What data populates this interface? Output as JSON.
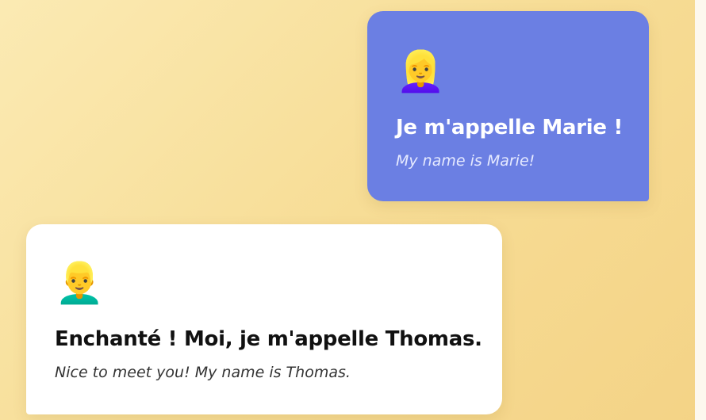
{
  "messages": [
    {
      "speaker": "Marie",
      "avatar_icon": "woman-blond-hair-emoji",
      "avatar_glyph": "👱‍♀️",
      "french": "Je m'appelle Marie !",
      "english": "My name is Marie!",
      "bubble_color": "#6b7fe3",
      "text_color": "#ffffff",
      "align": "right"
    },
    {
      "speaker": "Thomas",
      "avatar_icon": "man-blond-hair-emoji",
      "avatar_glyph": "👱‍♂️",
      "french": "Enchanté ! Moi, je m'appelle Thomas.",
      "english": "Nice to meet you! My name is Thomas.",
      "bubble_color": "#ffffff",
      "text_color": "#111111",
      "align": "left"
    }
  ],
  "colors": {
    "background_gradient_start": "#fbeab3",
    "background_gradient_end": "#f4d386"
  }
}
